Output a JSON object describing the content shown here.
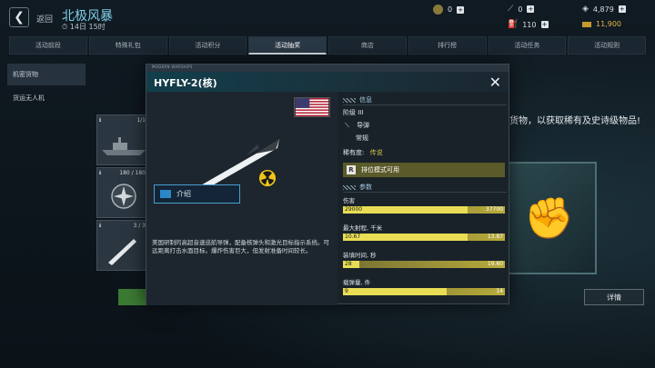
{
  "topbar": {
    "back_label": "返回",
    "title": "北极风暴",
    "timer": "14日 15时"
  },
  "resources": [
    {
      "icon": "gold-coin-icon",
      "value": "0"
    },
    {
      "icon": "missile-ticket-icon",
      "value": "0"
    },
    {
      "icon": "silver-icon",
      "value": "4,879"
    },
    {
      "icon": "fuel-icon",
      "value": "110"
    },
    {
      "icon": "gold-bar-icon",
      "value": "11,900"
    }
  ],
  "tabs": [
    "活动前段",
    "特殊礼包",
    "活动积分",
    "活动抽奖",
    "商店",
    "排行榜",
    "活动任务",
    "活动规则"
  ],
  "active_tab": 3,
  "sidebar": [
    "机密货物",
    "货运无人机"
  ],
  "cards": [
    {
      "label": "1/1"
    },
    {
      "label": "180 / 180"
    },
    {
      "label": "3 / 3"
    }
  ],
  "promo": "货物，以获取稀有及史诗级物品!",
  "detail_button": "详情",
  "modal": {
    "strip": "MODERN WARSHIPS",
    "title": "HYFLY-2(核)",
    "intro_label": "介绍",
    "description": "美国研制的高超音速巡航导弹，配备核弹头和激光目标指示系统。可远距离打击水面目标。爆炸伤害巨大，但发射准备时间较长。",
    "info_header": "信息",
    "tier": "阶级 III",
    "type": "导弹",
    "subtype": "常规",
    "rarity_label": "稀有度:",
    "rarity_value": "传说",
    "rank_mode": "排位模式可用",
    "params_header": "参数",
    "stats": [
      {
        "label": "伤害",
        "value": "29000",
        "max": "37700",
        "fraction": 0.77
      },
      {
        "label": "最大射程, 千米",
        "value": "10.67",
        "max": "13.87",
        "fraction": 0.77
      },
      {
        "label": "装填时间, 秒",
        "value": "28",
        "max": "19.60",
        "fraction": 0.1
      },
      {
        "label": "载弹量, 件",
        "value": "9",
        "max": "14",
        "fraction": 0.64
      }
    ]
  },
  "colors": {
    "accent": "#7fd0e8",
    "rarity": "#d7c44b",
    "stat_fill": "#b7ab3a"
  }
}
